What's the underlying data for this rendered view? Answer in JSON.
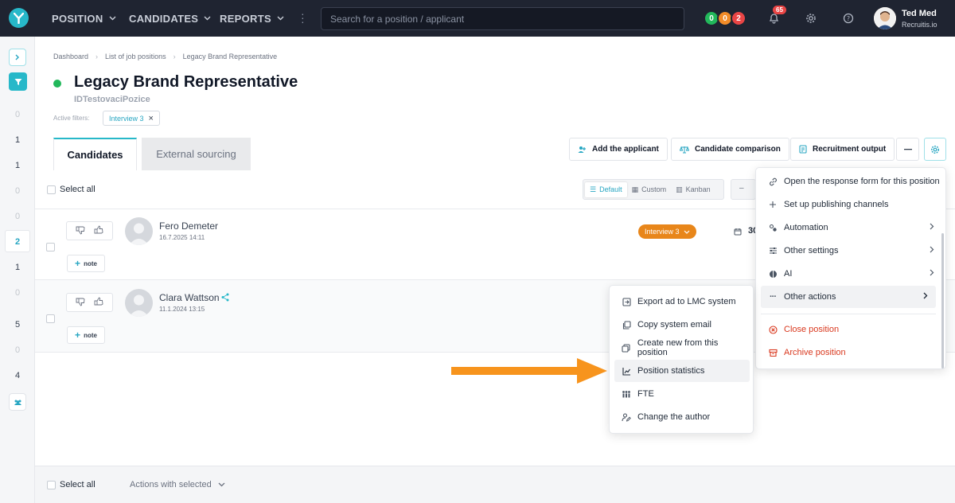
{
  "topbar": {
    "nav": [
      {
        "label": "POSITION"
      },
      {
        "label": "CANDIDATES"
      },
      {
        "label": "REPORTS"
      }
    ],
    "search_placeholder": "Search for a position / applicant",
    "status_dots": [
      {
        "value": "0",
        "color": "#22b85b"
      },
      {
        "value": "0",
        "color": "#f28c28"
      },
      {
        "value": "2",
        "color": "#e94545"
      }
    ],
    "notifications_count": "65",
    "user": {
      "name": "Ted Med",
      "org": "Recruitis.io"
    }
  },
  "sidebar": {
    "counts": [
      "0",
      "1",
      "1",
      "0",
      "0",
      "2",
      "1",
      "0",
      "5",
      "0",
      "4"
    ],
    "active_index": 5
  },
  "breadcrumb": [
    "Dashboard",
    "List of job positions",
    "Legacy Brand Representative"
  ],
  "position": {
    "title": "Legacy Brand Representative",
    "id_label": "IDTestovaciPozice",
    "active_filters_label": "Active filters:",
    "filter_chip": "Interview 3"
  },
  "tabs": [
    "Candidates",
    "External sourcing"
  ],
  "actions": {
    "add_applicant": "Add the applicant",
    "comparison": "Candidate comparison",
    "output": "Recruitment output"
  },
  "list": {
    "select_all": "Select all",
    "views": [
      "Default",
      "Custom",
      "Kanban"
    ],
    "candidates": [
      {
        "name": "Fero Demeter",
        "date": "16.7.2025 14:11",
        "stage": "Interview 3",
        "score": "30"
      },
      {
        "name": "Clara Wattson",
        "date": "11.1.2024 13:15"
      }
    ],
    "note_label": "note"
  },
  "footer": {
    "select_all": "Select all",
    "actions_with_selected": "Actions with selected"
  },
  "settings_menu": {
    "items": [
      {
        "label": "Open the response form for this position",
        "icon": "link-icon"
      },
      {
        "label": "Set up publishing channels",
        "icon": "plus-icon"
      },
      {
        "label": "Automation",
        "icon": "automation-icon",
        "submenu": true
      },
      {
        "label": "Other settings",
        "icon": "sliders-icon",
        "submenu": true
      },
      {
        "label": "AI",
        "icon": "ai-icon",
        "submenu": true
      },
      {
        "label": "Other actions",
        "icon": "more-icon",
        "submenu": true,
        "highlighted": true
      },
      {
        "label": "Close position",
        "icon": "close-circle-icon",
        "danger": true
      },
      {
        "label": "Archive position",
        "icon": "archive-icon",
        "danger": true
      }
    ]
  },
  "other_actions_menu": {
    "items": [
      {
        "label": "Export ad to LMC system",
        "icon": "export-icon"
      },
      {
        "label": "Copy system email",
        "icon": "copy-icon"
      },
      {
        "label": "Create new from this position",
        "icon": "duplicate-icon"
      },
      {
        "label": "Position statistics",
        "icon": "chart-icon",
        "highlighted": true
      },
      {
        "label": "FTE",
        "icon": "people-icon"
      },
      {
        "label": "Change the author",
        "icon": "user-edit-icon"
      }
    ]
  }
}
